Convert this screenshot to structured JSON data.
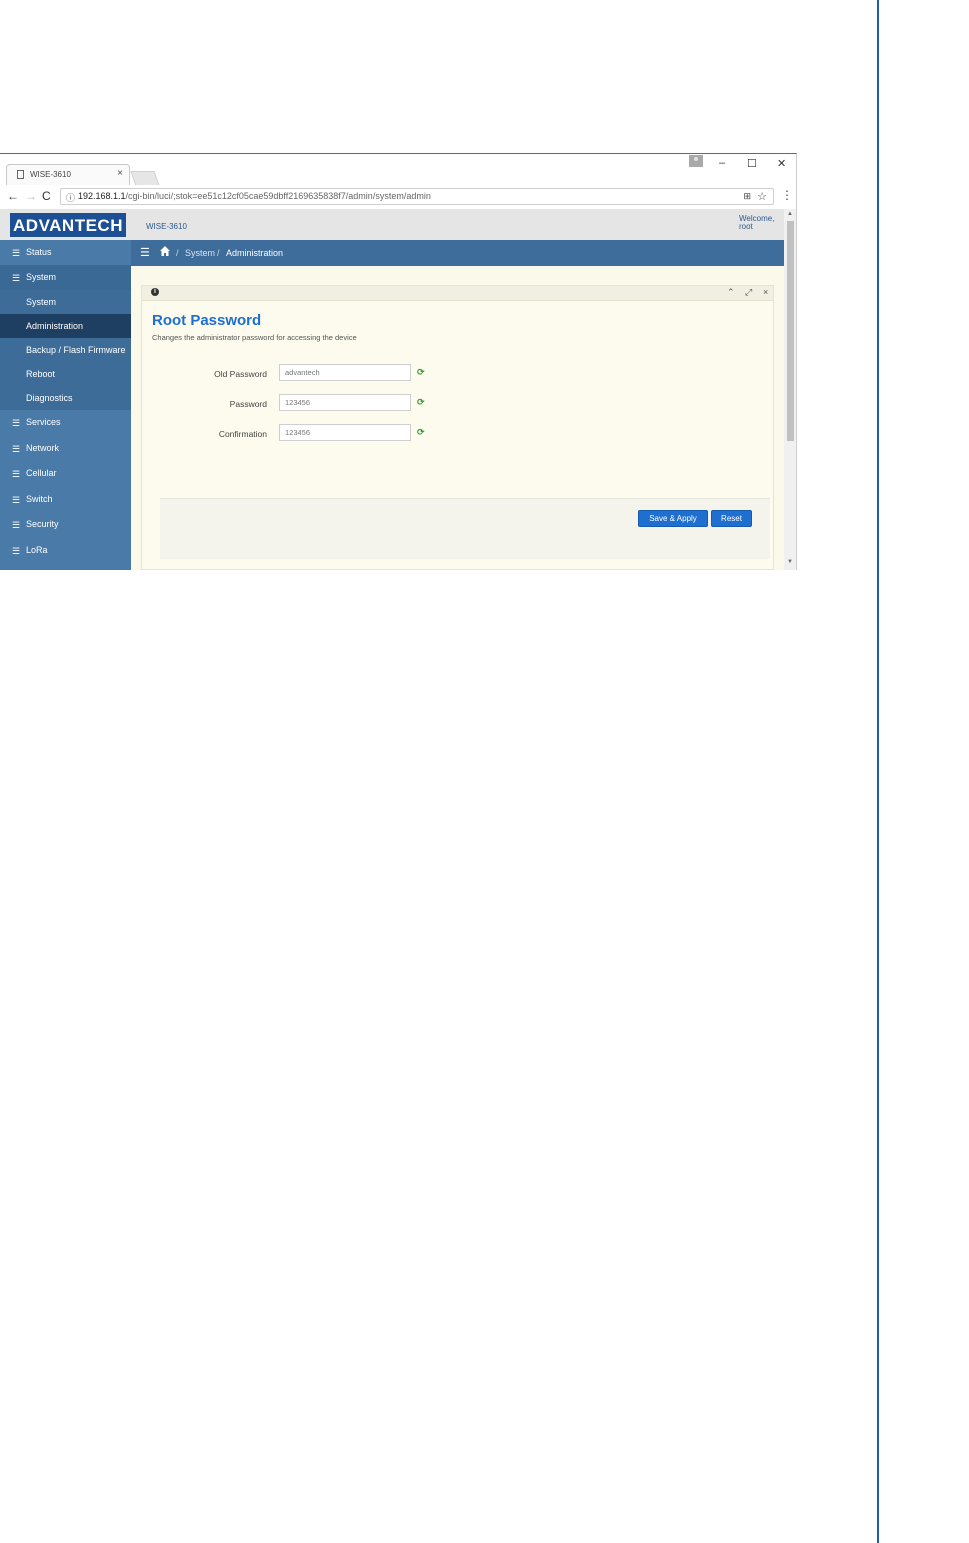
{
  "browser": {
    "tab_title": "WISE-3610",
    "tab_close": "×",
    "win_minimize": "–",
    "win_maximize": "☐",
    "win_close": "✕",
    "url_prefix": "192.168.1.1",
    "url_rest": "/cgi-bin/luci/;stok=ee51c12cf05cae59dbff2169635838f7/admin/system/admin"
  },
  "header": {
    "logo": "ADVANTECH",
    "device": "WISE-3610",
    "welcome": "Welcome,",
    "user": "root"
  },
  "sidebar": {
    "items": [
      {
        "label": "Status"
      },
      {
        "label": "System"
      },
      {
        "label": "Services"
      },
      {
        "label": "Network"
      },
      {
        "label": "Cellular"
      },
      {
        "label": "Switch"
      },
      {
        "label": "Security"
      },
      {
        "label": "LoRa"
      }
    ],
    "sub_items": [
      {
        "label": "System"
      },
      {
        "label": "Administration"
      },
      {
        "label": "Backup / Flash Firmware"
      },
      {
        "label": "Reboot"
      },
      {
        "label": "Diagnostics"
      }
    ]
  },
  "breadcrumb": {
    "sep": "/",
    "system": "System",
    "current": "Administration"
  },
  "panel": {
    "title": "Root Password",
    "description": "Changes the administrator password for accessing the device",
    "fields": [
      {
        "label": "Old Password",
        "value": "advantech"
      },
      {
        "label": "Password",
        "value": "123456"
      },
      {
        "label": "Confirmation",
        "value": "123456"
      }
    ],
    "save_label": "Save & Apply",
    "reset_label": "Reset"
  },
  "colors": {
    "brand": "#1d4f95",
    "sidebar": "#4a7aa8",
    "active": "#1f3f62",
    "accent": "#1f6fd0",
    "title": "#1e6fd1"
  }
}
